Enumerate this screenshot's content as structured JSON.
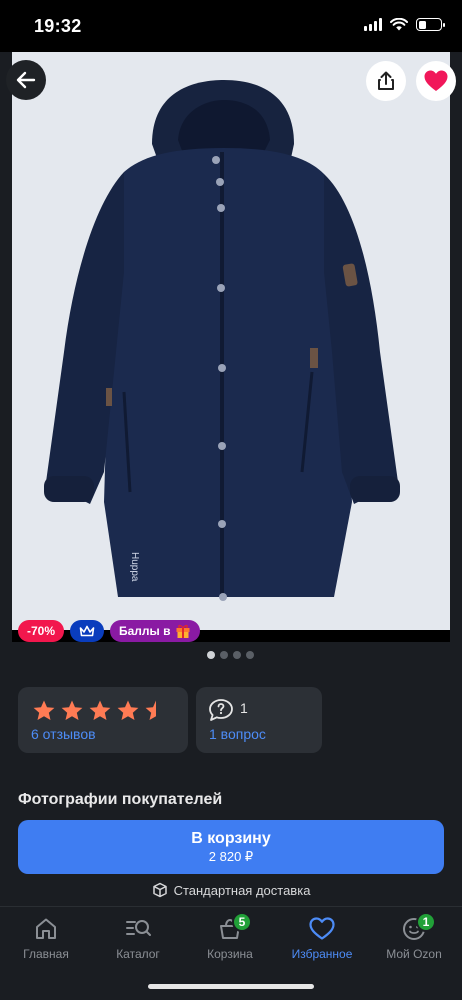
{
  "status_bar": {
    "time": "19:32",
    "battery_level": 0.35
  },
  "product": {
    "image_alt": "jacket-photo",
    "colors": {
      "jacket": "#1b2a4e",
      "background": "#e4e8ee"
    },
    "brand_mark": "Huppa",
    "gallery_dots": 4,
    "gallery_active_index": 0
  },
  "badges": {
    "discount": "-70%",
    "points": "Баллы в"
  },
  "reviews": {
    "rating": 4.5,
    "count_label": "6 отзывов"
  },
  "questions": {
    "count": "1",
    "label": "1 вопрос"
  },
  "customer_photos_title": "Фотографии покупателей",
  "cart": {
    "label": "В корзину",
    "price": "2 820 ₽"
  },
  "delivery_label": "Стандартная доставка",
  "tabs": [
    {
      "label": "Главная",
      "icon": "home-icon"
    },
    {
      "label": "Каталог",
      "icon": "catalog-search-icon"
    },
    {
      "label": "Корзина",
      "icon": "cart-icon",
      "badge": "5"
    },
    {
      "label": "Избранное",
      "icon": "heart-icon",
      "active": true
    },
    {
      "label": "Мой Ozon",
      "icon": "profile-icon",
      "badge": "1"
    }
  ],
  "accent_colors": {
    "primary": "#3f7df2",
    "discount": "#f2174d",
    "star": "#ff7b54",
    "badge_green": "#21a038"
  }
}
